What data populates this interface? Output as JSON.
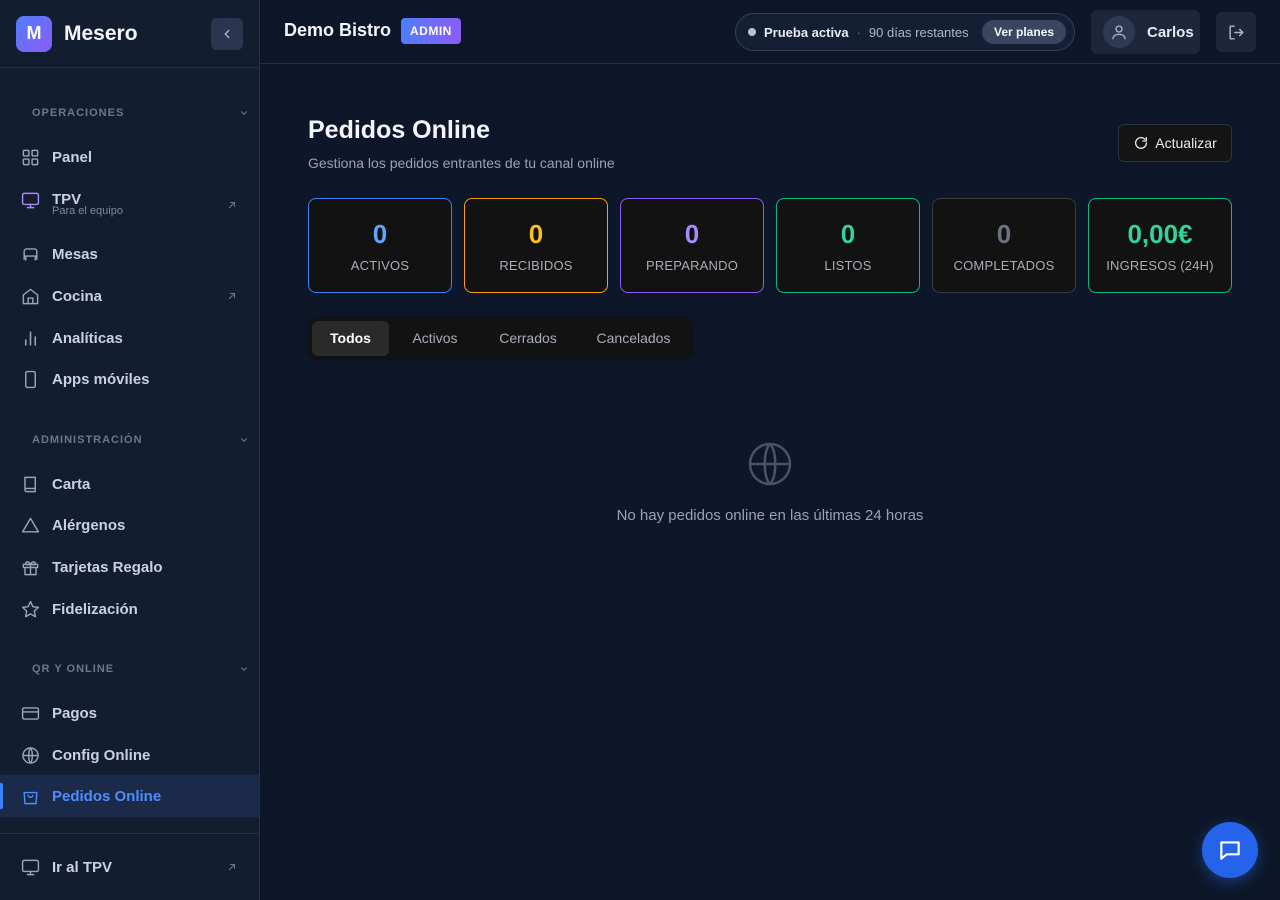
{
  "app": {
    "logo_letter": "M",
    "name": "Mesero"
  },
  "sidebar": {
    "sections": [
      {
        "title": "OPERACIONES"
      },
      {
        "title": "ADMINISTRACIÓN"
      },
      {
        "title": "QR Y ONLINE"
      }
    ],
    "operaciones": [
      {
        "label": "Panel",
        "icon": "grid-icon"
      },
      {
        "label": "TPV",
        "sub": "Para el equipo",
        "icon": "monitor-icon",
        "external": true
      },
      {
        "label": "Mesas",
        "icon": "table-icon"
      },
      {
        "label": "Cocina",
        "icon": "home-icon",
        "external": true
      },
      {
        "label": "Analíticas",
        "icon": "bar-chart-icon"
      },
      {
        "label": "Apps móviles",
        "icon": "smartphone-icon"
      }
    ],
    "administracion": [
      {
        "label": "Carta",
        "icon": "book-icon"
      },
      {
        "label": "Alérgenos",
        "icon": "alert-triangle-icon"
      },
      {
        "label": "Tarjetas Regalo",
        "icon": "gift-icon"
      },
      {
        "label": "Fidelización",
        "icon": "star-icon"
      }
    ],
    "qr_online": [
      {
        "label": "Pagos",
        "icon": "credit-card-icon"
      },
      {
        "label": "Config Online",
        "icon": "globe-icon"
      },
      {
        "label": "Pedidos Online",
        "icon": "shopping-bag-icon",
        "active": true
      }
    ],
    "footer": {
      "label": "Ir al TPV",
      "icon": "monitor-icon"
    }
  },
  "header": {
    "shop_name": "Demo Bistro",
    "role_badge": "ADMIN",
    "trial": {
      "label": "Prueba activa",
      "separator": "·",
      "days_left": "90 días restantes",
      "plans_button": "Ver planes"
    },
    "user": {
      "name": "Carlos"
    }
  },
  "main": {
    "title": "Pedidos Online",
    "subtitle": "Gestiona los pedidos entrantes de tu canal online",
    "refresh_label": "Actualizar",
    "stats": [
      {
        "value": "0",
        "label": "ACTIVOS",
        "color": "#60a5fa",
        "border": "#3b82f6"
      },
      {
        "value": "0",
        "label": "RECIBIDOS",
        "color": "#fbbf24",
        "border": "#f59e0b"
      },
      {
        "value": "0",
        "label": "PREPARANDO",
        "color": "#a78bfa",
        "border": "#8b5cf6"
      },
      {
        "value": "0",
        "label": "LISTOS",
        "color": "#34d399",
        "border": "#10b981"
      },
      {
        "value": "0",
        "label": "COMPLETADOS",
        "color": "#6b7280",
        "border": "#3a3a3a"
      },
      {
        "value": "0,00€",
        "label": "INGRESOS (24H)",
        "color": "#34d399",
        "border": "#10b981"
      }
    ],
    "tabs": [
      {
        "label": "Todos",
        "active": true
      },
      {
        "label": "Activos"
      },
      {
        "label": "Cerrados"
      },
      {
        "label": "Cancelados"
      }
    ],
    "empty_state": "No hay pedidos online en las últimas 24 horas"
  },
  "colors": {
    "accent": "#3b82f6",
    "background": "#0e1729",
    "sidebar": "#131d30"
  }
}
